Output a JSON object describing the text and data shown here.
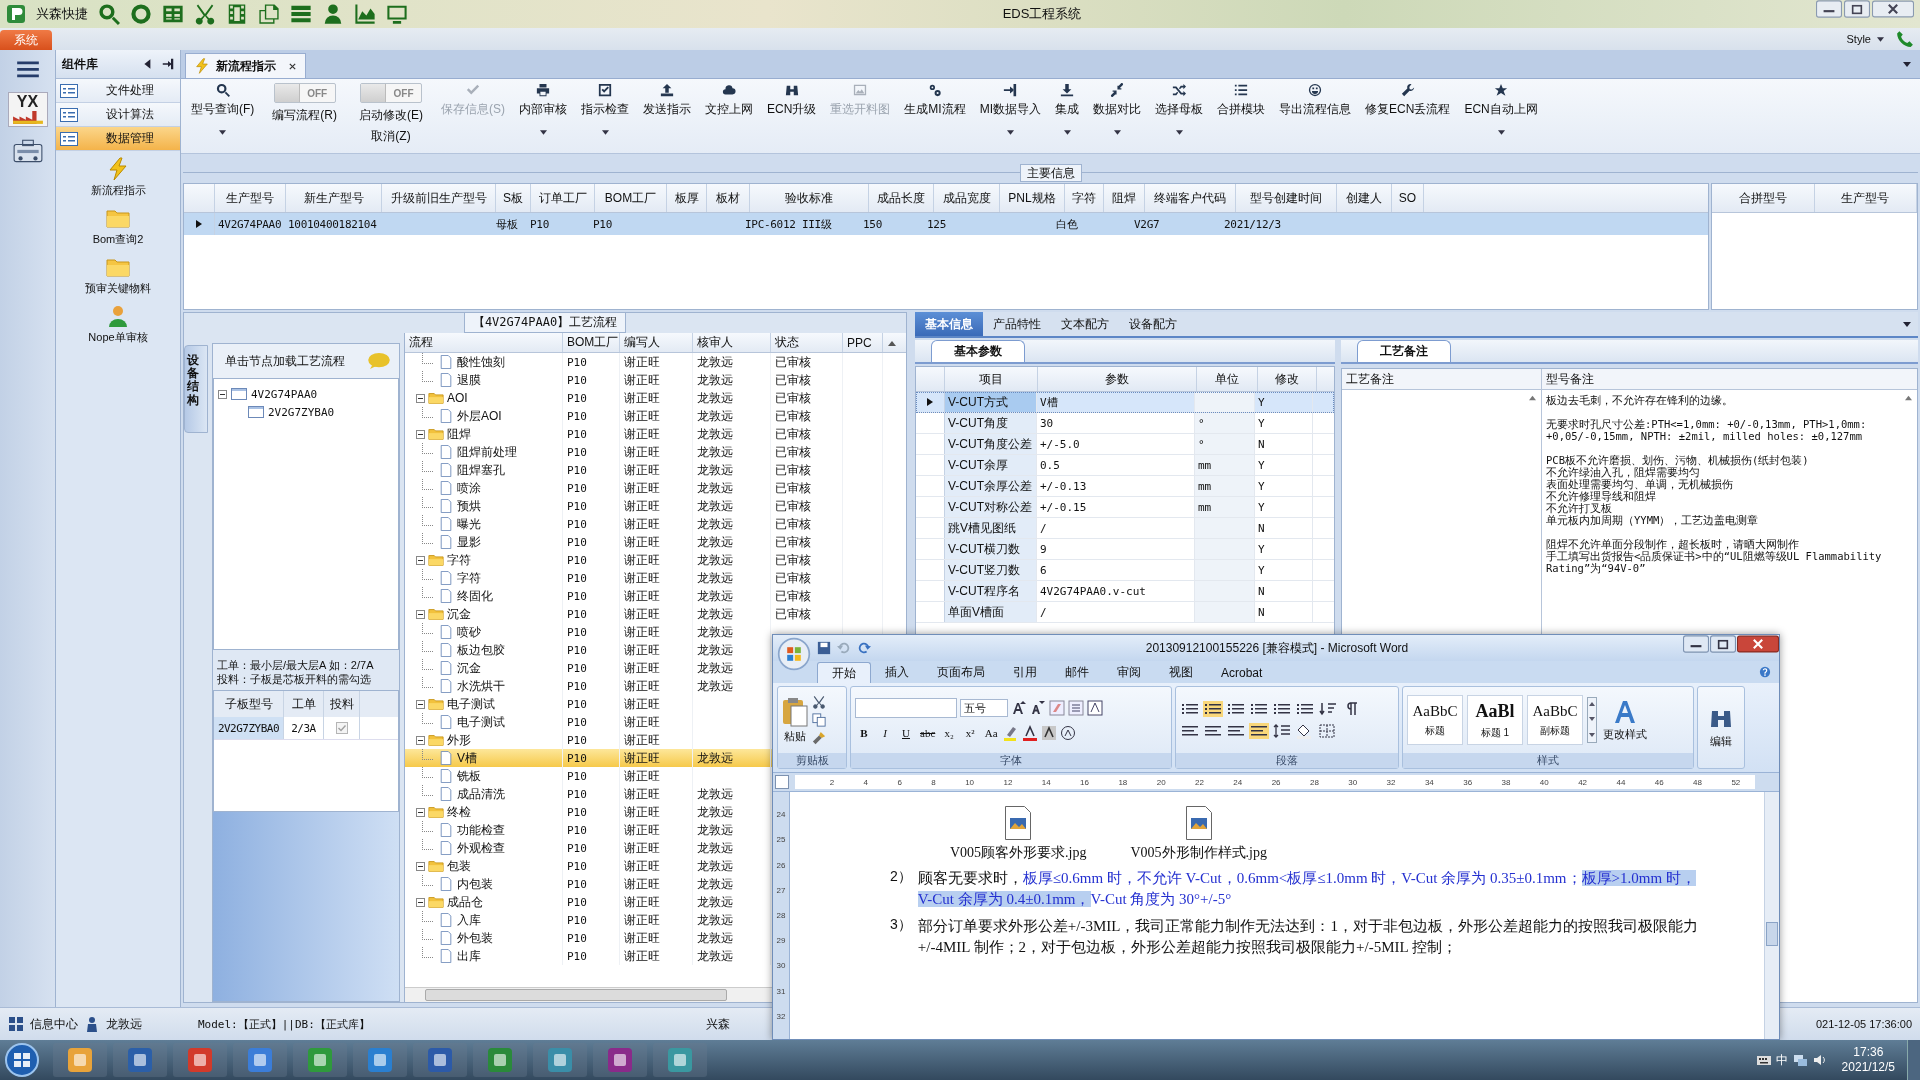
{
  "title_bar": {
    "app_label": "兴森快捷",
    "title": "EDS工程系统"
  },
  "menu_tabs": [
    {
      "label": "系统",
      "selected": true
    }
  ],
  "style_menu": {
    "label": "Style"
  },
  "strip": {
    "logo_text": "YX"
  },
  "sidebar": {
    "title": "组件库",
    "items": [
      {
        "label": "文件处理",
        "selected": false
      },
      {
        "label": "设计算法",
        "selected": false
      },
      {
        "label": "数据管理",
        "selected": true
      }
    ],
    "tools": [
      {
        "label": "新流程指示",
        "kind": "bolt"
      },
      {
        "label": "Bom查询2",
        "kind": "folder"
      },
      {
        "label": "预审关键物料",
        "kind": "folder"
      },
      {
        "label": "Nope单审核",
        "kind": "person"
      }
    ]
  },
  "doc_tabs": [
    {
      "label": "新流程指示",
      "selected": true
    }
  ],
  "toolbar": [
    {
      "kind": "button",
      "label": "型号查询(F)",
      "disabled": false,
      "dropdown": true
    },
    {
      "kind": "toggle",
      "label": "编写流程(R)",
      "value": "OFF",
      "on": false
    },
    {
      "kind": "toggle",
      "label": "启动修改(E)",
      "value": "OFF",
      "on": false,
      "sublabel": "取消(Z)"
    },
    {
      "kind": "button",
      "label": "保存信息(S)",
      "disabled": true,
      "dropdown": false
    },
    {
      "kind": "button",
      "label": "内部审核",
      "disabled": false,
      "dropdown": true
    },
    {
      "kind": "button",
      "label": "指示检查",
      "disabled": false,
      "dropdown": true
    },
    {
      "kind": "button",
      "label": "发送指示",
      "disabled": false,
      "dropdown": false
    },
    {
      "kind": "button",
      "label": "文控上网",
      "disabled": false,
      "dropdown": false
    },
    {
      "kind": "button",
      "label": "ECN升级",
      "disabled": false,
      "dropdown": false
    },
    {
      "kind": "button",
      "label": "重选开料图",
      "disabled": true,
      "dropdown": false
    },
    {
      "kind": "button",
      "label": "生成MI流程",
      "disabled": false,
      "dropdown": false
    },
    {
      "kind": "button",
      "label": "MI数据导入",
      "disabled": false,
      "dropdown": true
    },
    {
      "kind": "button",
      "label": "集成",
      "disabled": false,
      "dropdown": true
    },
    {
      "kind": "button",
      "label": "数据对比",
      "disabled": false,
      "dropdown": true
    },
    {
      "kind": "button",
      "label": "选择母板",
      "disabled": false,
      "dropdown": true
    },
    {
      "kind": "button",
      "label": "合拼模块",
      "disabled": false,
      "dropdown": false
    },
    {
      "kind": "button",
      "label": "导出流程信息",
      "disabled": false,
      "dropdown": false
    },
    {
      "kind": "button",
      "label": "修复ECN丢流程",
      "disabled": false,
      "dropdown": false
    },
    {
      "kind": "button",
      "label": "ECN自动上网",
      "disabled": false,
      "dropdown": true
    }
  ],
  "main_info": {
    "title": "主要信息",
    "columns": [
      "生产型号",
      "新生产型号",
      "升级前旧生产型号",
      "S板",
      "订单工厂",
      "BOM工厂",
      "板厚",
      "板材",
      "验收标准",
      "成品长度",
      "成品宽度",
      "PNL规格",
      "字符",
      "阻焊",
      "终端客户代码",
      "型号创建时间",
      "创建人",
      "SO"
    ],
    "rows": [
      {
        "selected": true,
        "cells": [
          "4V2G74PAA0",
          "10010400182104",
          null,
          "母板",
          "P10",
          "P10",
          null,
          null,
          "IPC-6012 III级",
          "150",
          "125",
          null,
          "白色",
          null,
          "V2G7",
          "2021/12/3",
          null,
          null
        ]
      }
    ]
  },
  "merge_table": {
    "columns": [
      "合拼型号",
      "生产型号"
    ]
  },
  "process_panel": {
    "title": "【4V2G74PAA0】工艺流程",
    "side_tab": "设备结构",
    "hint": "单击节点加载工艺流程",
    "board_tree": [
      {
        "label": "4V2G74PAA0",
        "expanded": true,
        "children": [
          {
            "label": "2V2G7ZYBA0"
          }
        ]
      }
    ],
    "notes": [
      "工单：最小层/最大层A 如：2/7A",
      "投料：子板是芯板开料的需勾选"
    ],
    "sub_table": {
      "columns": [
        "子板型号",
        "工单",
        "投料"
      ],
      "rows": [
        {
          "model": "2V2G7ZYBA0",
          "order": "2/3A",
          "checked": true
        }
      ]
    }
  },
  "flow_grid": {
    "columns": [
      "流程",
      "BOM工厂",
      "编写人",
      "核审人",
      "状态",
      "PPC"
    ],
    "nodes": [
      {
        "children": [
          {
            "label": "酸性蚀刻",
            "bom": "P10",
            "writer": "谢正旺",
            "reviewer": "龙敦远",
            "status": "已审核",
            "selected": false
          },
          {
            "label": "退膜",
            "bom": "P10",
            "writer": "谢正旺",
            "reviewer": "龙敦远",
            "status": "已审核",
            "selected": false
          }
        ]
      },
      {
        "label": "AOI",
        "bom": "P10",
        "writer": "谢正旺",
        "reviewer": "龙敦远",
        "status": "已审核",
        "selected": false,
        "expanded": true,
        "children": [
          {
            "label": "外层AOI",
            "bom": "P10",
            "writer": "谢正旺",
            "reviewer": "龙敦远",
            "status": "已审核",
            "selected": false
          }
        ]
      },
      {
        "label": "阻焊",
        "bom": "P10",
        "writer": "谢正旺",
        "reviewer": "龙敦远",
        "status": "已审核",
        "selected": false,
        "expanded": true,
        "children": [
          {
            "label": "阻焊前处理",
            "bom": "P10",
            "writer": "谢正旺",
            "reviewer": "龙敦远",
            "status": "已审核",
            "selected": false
          },
          {
            "label": "阻焊塞孔",
            "bom": "P10",
            "writer": "谢正旺",
            "reviewer": "龙敦远",
            "status": "已审核",
            "selected": false
          },
          {
            "label": "喷涂",
            "bom": "P10",
            "writer": "谢正旺",
            "reviewer": "龙敦远",
            "status": "已审核",
            "selected": false
          },
          {
            "label": "预烘",
            "bom": "P10",
            "writer": "谢正旺",
            "reviewer": "龙敦远",
            "status": "已审核",
            "selected": false
          },
          {
            "label": "曝光",
            "bom": "P10",
            "writer": "谢正旺",
            "reviewer": "龙敦远",
            "status": "已审核",
            "selected": false
          },
          {
            "label": "显影",
            "bom": "P10",
            "writer": "谢正旺",
            "reviewer": "龙敦远",
            "status": "已审核",
            "selected": false
          }
        ]
      },
      {
        "label": "字符",
        "bom": "P10",
        "writer": "谢正旺",
        "reviewer": "龙敦远",
        "status": "已审核",
        "selected": false,
        "expanded": true,
        "children": [
          {
            "label": "字符",
            "bom": "P10",
            "writer": "谢正旺",
            "reviewer": "龙敦远",
            "status": "已审核",
            "selected": false
          },
          {
            "label": "终固化",
            "bom": "P10",
            "writer": "谢正旺",
            "reviewer": "龙敦远",
            "status": "已审核",
            "selected": false
          }
        ]
      },
      {
        "label": "沉金",
        "bom": "P10",
        "writer": "谢正旺",
        "reviewer": "龙敦远",
        "status": "已审核",
        "selected": false,
        "expanded": true,
        "children": [
          {
            "label": "喷砂",
            "bom": "P10",
            "writer": "谢正旺",
            "reviewer": "龙敦远",
            "selected": false
          },
          {
            "label": "板边包胶",
            "bom": "P10",
            "writer": "谢正旺",
            "reviewer": "龙敦远",
            "selected": false
          },
          {
            "label": "沉金",
            "bom": "P10",
            "writer": "谢正旺",
            "reviewer": "龙敦远",
            "selected": false
          },
          {
            "label": "水洗烘干",
            "bom": "P10",
            "writer": "谢正旺",
            "reviewer": "龙敦远",
            "selected": false
          }
        ]
      },
      {
        "label": "电子测试",
        "bom": "P10",
        "writer": "谢正旺",
        "selected": false,
        "expanded": true,
        "children": [
          {
            "label": "电子测试",
            "bom": "P10",
            "writer": "谢正旺",
            "selected": false
          }
        ]
      },
      {
        "label": "外形",
        "bom": "P10",
        "writer": "谢正旺",
        "selected": false,
        "expanded": true,
        "children": [
          {
            "label": "V槽",
            "bom": "P10",
            "writer": "谢正旺",
            "reviewer": "龙敦远",
            "selected": true
          },
          {
            "label": "铣板",
            "bom": "P10",
            "writer": "谢正旺",
            "selected": false
          },
          {
            "label": "成品清洗",
            "bom": "P10",
            "writer": "谢正旺",
            "reviewer": "龙敦远",
            "selected": false
          }
        ]
      },
      {
        "label": "终检",
        "bom": "P10",
        "writer": "谢正旺",
        "reviewer": "龙敦远",
        "selected": false,
        "expanded": true,
        "children": [
          {
            "label": "功能检查",
            "bom": "P10",
            "writer": "谢正旺",
            "reviewer": "龙敦远",
            "selected": false
          },
          {
            "label": "外观检查",
            "bom": "P10",
            "writer": "谢正旺",
            "reviewer": "龙敦远",
            "selected": false
          }
        ]
      },
      {
        "label": "包装",
        "bom": "P10",
        "writer": "谢正旺",
        "reviewer": "龙敦远",
        "selected": false,
        "expanded": true,
        "children": [
          {
            "label": "内包装",
            "bom": "P10",
            "writer": "谢正旺",
            "reviewer": "龙敦远",
            "selected": false
          }
        ]
      },
      {
        "label": "成品仓",
        "bom": "P10",
        "writer": "谢正旺",
        "reviewer": "龙敦远",
        "selected": false,
        "expanded": true,
        "children": [
          {
            "label": "入库",
            "bom": "P10",
            "writer": "谢正旺",
            "reviewer": "龙敦远",
            "selected": false
          },
          {
            "label": "外包装",
            "bom": "P10",
            "writer": "谢正旺",
            "reviewer": "龙敦远",
            "selected": false
          },
          {
            "label": "出库",
            "bom": "P10",
            "writer": "谢正旺",
            "reviewer": "龙敦远",
            "selected": false
          }
        ]
      }
    ]
  },
  "detail_tabs": [
    {
      "label": "基本信息",
      "selected": true
    },
    {
      "label": "产品特性",
      "selected": false
    },
    {
      "label": "文本配方",
      "selected": false
    },
    {
      "label": "设备配方",
      "selected": false
    }
  ],
  "params": {
    "title": "基本参数",
    "columns": [
      "项目",
      "参数",
      "单位",
      "修改"
    ],
    "rows": [
      {
        "item": "V-CUT方式",
        "value": "V槽",
        "modify": "Y",
        "selected": true
      },
      {
        "item": "V-CUT角度",
        "value": "30",
        "unit": "°",
        "modify": "Y",
        "selected": false
      },
      {
        "item": "V-CUT角度公差",
        "value": "+/-5.0",
        "unit": "°",
        "modify": "N",
        "selected": false
      },
      {
        "item": "V-CUT余厚",
        "value": "0.5",
        "unit": "mm",
        "modify": "Y",
        "selected": false
      },
      {
        "item": "V-CUT余厚公差",
        "value": "+/-0.13",
        "unit": "mm",
        "modify": "Y",
        "selected": false
      },
      {
        "item": "V-CUT对称公差",
        "value": "+/-0.15",
        "unit": "mm",
        "modify": "Y",
        "selected": false
      },
      {
        "item": "跳V槽见图纸",
        "value": "/",
        "modify": "N",
        "selected": false
      },
      {
        "item": "V-CUT横刀数",
        "value": "9",
        "modify": "Y",
        "selected": false
      },
      {
        "item": "V-CUT竖刀数",
        "value": "6",
        "modify": "Y",
        "selected": false
      },
      {
        "item": "V-CUT程序名",
        "value": "4V2G74PAA0.v-cut",
        "modify": "N",
        "selected": false
      },
      {
        "item": "单面V槽面",
        "value": "/",
        "modify": "N",
        "selected": false
      }
    ]
  },
  "remarks": {
    "title": "工艺备注",
    "columns": [
      "工艺备注",
      "型号备注"
    ],
    "paragraphs": [
      [
        "板边去毛刺，不允许存在锋利的边缘。"
      ],
      [
        "无要求时孔尺寸公差:PTH<=1,0mm: +0/-0,13mm, PTH>1,0mm:",
        "+0,05/-0,15mm, NPTH: ±2mil, milled holes: ±0,127mm"
      ],
      [
        "PCB板不允许磨损、划伤、污物、机械损伤(纸封包装)",
        "不允许绿油入孔，阻焊需要均匀",
        "表面处理需要均匀、单调，无机械损伤",
        "不允许修理导线和阻焊",
        "不允许打叉板",
        "单元板内加周期（YYMM），工艺边盖电测章"
      ],
      [
        "阻焊不允许单面分段制作，超长板时，请晒大网制作",
        "手工填写出货报告<品质保证书>中的“UL阻燃等级UL Flammability",
        "Rating”为“94V-0”"
      ]
    ]
  },
  "status_bar": {
    "items": [
      {
        "label": "信息中心"
      },
      {
        "label": "龙敦远"
      }
    ],
    "model": "Model:【正式】||DB:【正式库】",
    "company": "兴森",
    "datetime": "021-12-05 17:36:00"
  },
  "word": {
    "title": "20130912100155226 [兼容模式] - Microsoft Word",
    "tabs": [
      {
        "label": "开始",
        "selected": true
      },
      {
        "label": "插入",
        "selected": false
      },
      {
        "label": "页面布局",
        "selected": false
      },
      {
        "label": "引用",
        "selected": false
      },
      {
        "label": "邮件",
        "selected": false
      },
      {
        "label": "审阅",
        "selected": false
      },
      {
        "label": "视图",
        "selected": false
      },
      {
        "label": "Acrobat",
        "selected": false
      }
    ],
    "paste_label": "粘贴",
    "font_size": "五号",
    "format_buttons": [
      "B",
      "I",
      "U",
      "abc",
      "x₂",
      "x²",
      "Aa"
    ],
    "styles": [
      {
        "sample": "AaBbC",
        "label": "标题"
      },
      {
        "sample": "AaBl",
        "label": "标题 1"
      },
      {
        "sample": "AaBbC",
        "label": "副标题"
      }
    ],
    "change_styles": "更改样式",
    "edit": "编辑",
    "groups": [
      "剪贴板",
      "字体",
      "段落",
      "样式"
    ],
    "ruler_marks": [
      "2",
      "4",
      "6",
      "8",
      "10",
      "12",
      "14",
      "16",
      "18",
      "20",
      "22",
      "24",
      "26",
      "28",
      "30",
      "32",
      "34",
      "36",
      "38",
      "40",
      "42",
      "44",
      "46",
      "48",
      "52"
    ],
    "vruler_marks": [
      "24",
      "25",
      "26",
      "27",
      "28",
      "29",
      "30",
      "31",
      "32"
    ],
    "attachments": [
      "V005顾客外形要求.jpg",
      "V005外形制作样式.jpg"
    ],
    "paragraphs": [
      {
        "number": "2）",
        "segments": [
          {
            "kind": "plain",
            "text": "顾客无要求时，"
          },
          {
            "kind": "revision",
            "text": "板厚≤0.6mm 时，不允许 V-Cut，0.6mm<板厚≤1.0mm 时，V-Cut 余厚为 0.35±0.1mm；"
          },
          {
            "kind": "selected",
            "text": "板厚>1.0mm 时，V-Cut 余厚为 0.4±0.1mm，"
          },
          {
            "kind": "revision",
            "text": "V-Cut 角度为 30°+/-5°"
          }
        ]
      },
      {
        "number": "3）",
        "segments": [
          {
            "kind": "plain",
            "text": "部分订单要求外形公差+/-3MIL，我司正常能力制作无法达到：1，对于非包边板，外形公差超能力的按照我司极限能力+/-4MIL 制作；2，对于包边板，外形公差超能力按照我司极限能力+/-5MIL 控制；"
          }
        ]
      }
    ]
  },
  "taskbar": {
    "ime": "中",
    "time": "17:36",
    "date": "2021/12/5"
  }
}
